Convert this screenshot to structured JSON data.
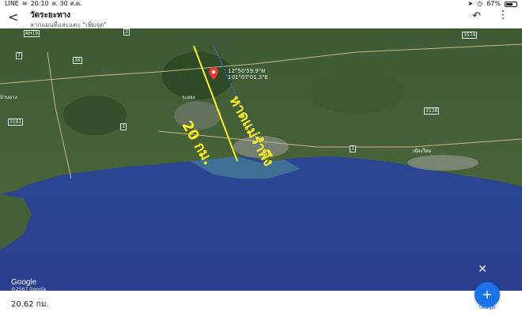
{
  "status_bar": {
    "carrier": "LINE",
    "time": "20:10",
    "date": "ส. 30 ส.ค.",
    "battery": "67%",
    "battery_level": 0.67
  },
  "header": {
    "title": "วัดระยะทาง",
    "subtitle": "ลากแผนที่และแตะ \"เพิ่มจุด\""
  },
  "map": {
    "coordinates_line1": "12°50'59.9\"N",
    "coordinates_line2": "101°07'01.3\"E",
    "annotation_distance": "20 กม.",
    "annotation_place": "หาดแม่รำพึง",
    "road_labels": [
      "AH19",
      "7",
      "36",
      "3",
      "3",
      "3574",
      "3138",
      "3191",
      "3"
    ],
    "place_labels": [
      "ระยอง",
      "บ้านฉาง",
      "เมืองใหม่"
    ],
    "logo": "Google",
    "copyright": "©2567 Google"
  },
  "bottom": {
    "distance": "20.62 กม.",
    "add_point_label": "เพิ่มจุด"
  },
  "colors": {
    "sea": "#2f4f9a",
    "land": "#3b5a2a",
    "accent": "#1a73e8",
    "annotation": "#ffef1a"
  }
}
